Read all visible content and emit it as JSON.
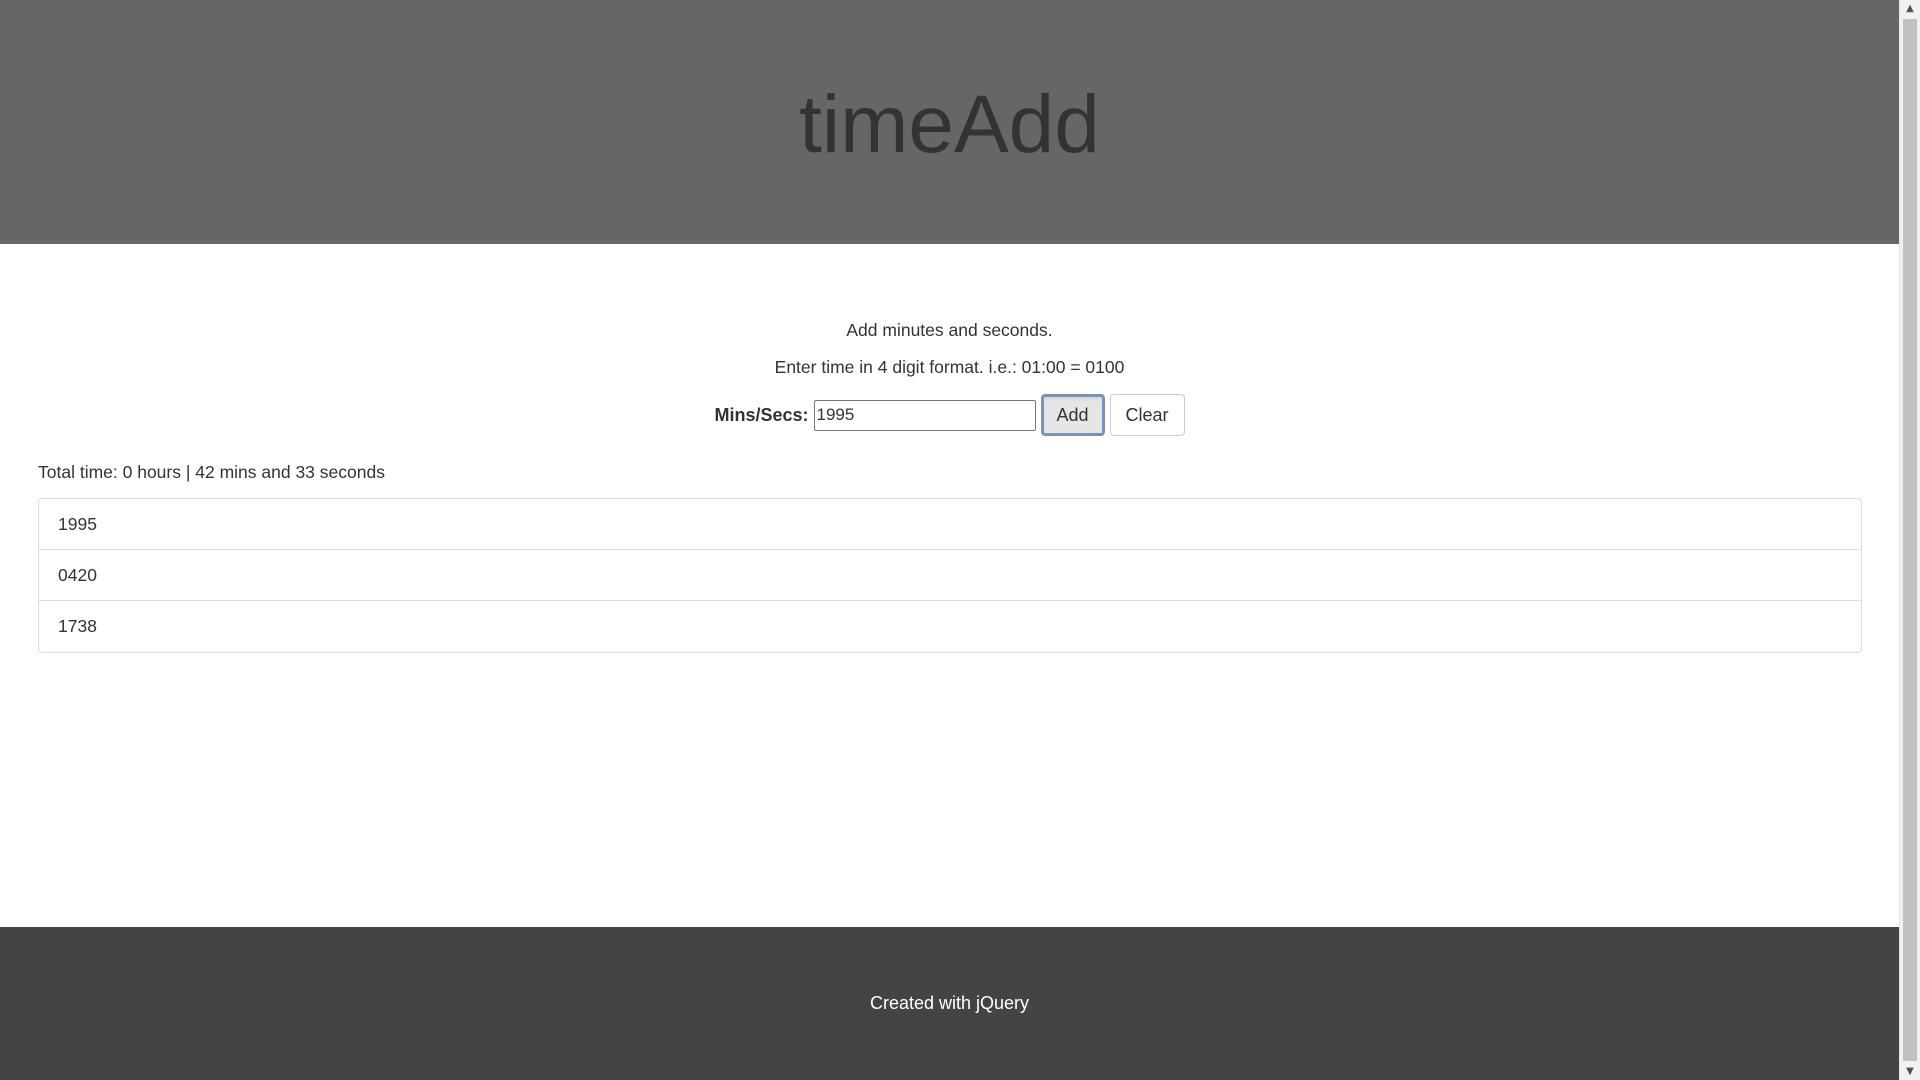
{
  "header": {
    "title": "timeAdd"
  },
  "intro": {
    "line1": "Add minutes and seconds.",
    "line2": "Enter time in 4 digit format. i.e.: 01:00 = 0100"
  },
  "form": {
    "label": "Mins/Secs:",
    "input_value": "1995",
    "add_label": "Add",
    "clear_label": "Clear"
  },
  "total": "Total time: 0 hours | 42 mins and 33 seconds",
  "entries": [
    "1995",
    "0420",
    "1738"
  ],
  "footer": {
    "text": "Created with jQuery"
  },
  "colors": {
    "header_bg": "#666666",
    "footer_bg": "#444444",
    "text": "#333333"
  },
  "icons": {
    "scroll_up": "scroll-up-arrow-icon",
    "scroll_down": "scroll-down-arrow-icon"
  }
}
